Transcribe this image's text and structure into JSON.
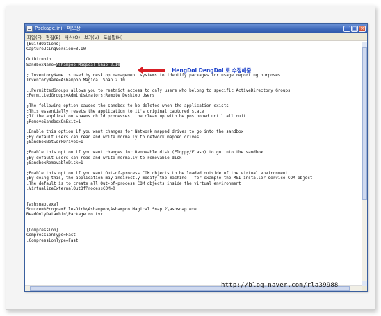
{
  "window": {
    "title": "Package.ini - 메모장",
    "buttons": {
      "minimize": "_",
      "maximize": "□",
      "close": "×"
    }
  },
  "menu": [
    "파일(F)",
    "편집(E)",
    "서식(O)",
    "보기(V)",
    "도움말(H)"
  ],
  "editor": {
    "lines": [
      "[BuildOptions]",
      "CaptureUsingVersion=3.10",
      "",
      "OutDir=bin",
      "",
      "",
      "; InventoryName is used by desktop management systems to identify packages for usage reporting purposes",
      "InventoryName=Ashampoo Magical Snap 2.10",
      "",
      ";;PermittedGroups allows you to restrict access to only users who belong to specific ActiveDirectory Groups",
      ";PermittedGroups=Administrators;Remote Desktop Users",
      "",
      ";The following option causes the sandbox to be deleted when the application exists",
      ";This essentially resets the application to it's original captured state",
      ";If the application spawns child processes, the clean up with be postponed until all quit",
      ";RemoveSandboxOnExit=1",
      "",
      ";Enable this option if you want changes for Network mapped drives to go into the sandbox",
      ";By default users can read and write normally to network mapped drives",
      ";SandboxNetworkDrives=1",
      "",
      ";Enable this option if you want changes for Removable disk (Floppy/Flash) to go into the sandbox",
      ";By default users can read and write normally to removable disk",
      ";SandboxRemovableDisk=1",
      "",
      ";Enable this option if you want Out-of-process COM objects to be loaded outside of the virtual environment",
      ";By doing this, the application may indirectly modify the machine - for example the MSI installer service COM object",
      ";The default is to create all Out-of-process COM objects inside the virtual environment",
      ";VirtualizeExternalOutOfProcessCOM=0",
      "",
      "",
      "[ashsnap.exe]",
      "Source=%ProgramFilesDir%\\Ashampoo\\Ashampoo Magical Snap 2\\ashsnap.exe",
      "ReadOnlyData=bin\\Package.ro.tvr",
      "",
      "",
      "[Compression]",
      "CompressionType=Fast",
      ";CompressionType=Fast"
    ],
    "highlight_line": {
      "prefix": "SandboxName=",
      "selected": "Ashampoo Magical Snap 2.10"
    }
  },
  "annotation": {
    "text": "HengDol DengDol 로 수정해줌",
    "arrow_color": "#d81f26",
    "text_color": "#1a3fc9"
  },
  "watermark": "http://blog.naver.com/rla39988",
  "colors": {
    "titlebar": "#3c67b8",
    "selection": "#3a3a3a"
  }
}
